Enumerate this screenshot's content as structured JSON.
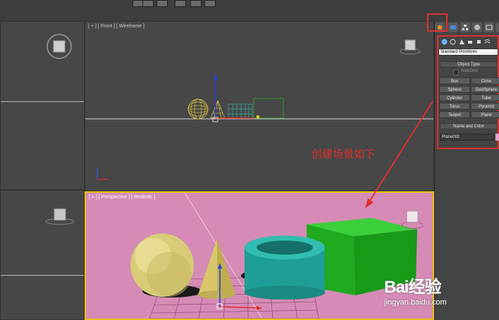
{
  "viewports": {
    "front_label": "[ + ] [ Front ] [ Wireframe ]",
    "perspective_label": "[ + ] [ Perspective ] [ Realistic ]"
  },
  "command_panel": {
    "category": "Standard Primitives",
    "object_type_title": "Object Type",
    "autogrid": "AutoGrid",
    "buttons": [
      "Box",
      "Cone",
      "Sphere",
      "GeoSphere",
      "Cylinder",
      "Tube",
      "Torus",
      "Pyramid",
      "Teapot",
      "Plane"
    ],
    "name_color_title": "Name and Color",
    "object_name": "Plane001",
    "object_color": "#e8a0c8"
  },
  "annotation": {
    "text": "创建场景如下",
    "color": "#e03030"
  },
  "watermark": {
    "brand": "Bai经验",
    "url": "jingyan.baidu.com"
  }
}
